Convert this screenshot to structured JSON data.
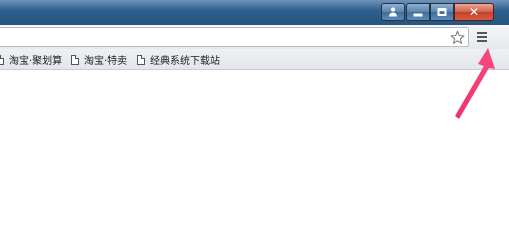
{
  "window": {
    "controls": {
      "user_icon": "user-icon",
      "minimize_icon": "minimize-icon",
      "maximize_icon": "maximize-icon",
      "close_icon": "close-icon",
      "close_glyph": "✕"
    },
    "titlebar_color": "#2f5f8f",
    "close_color": "#c2412a"
  },
  "toolbar": {
    "address_value": "",
    "star_icon": "star-icon",
    "menu_icon": "hamburger-menu-icon"
  },
  "bookmarks": [
    {
      "label": "淘宝·聚划算",
      "icon": "page-icon"
    },
    {
      "label": "淘宝·特卖",
      "icon": "page-icon"
    },
    {
      "label": "经典系统下载站",
      "icon": "page-icon"
    }
  ],
  "annotation": {
    "arrow_color": "#f0306a"
  }
}
